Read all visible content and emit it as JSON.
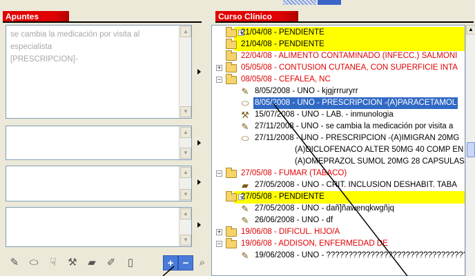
{
  "left_panel": {
    "title": "Apuntes",
    "notes": [
      {
        "text": "se cambia la medicación por visita al\nespecialista\n[PRESCRIPCION]-"
      },
      {
        "text": ""
      },
      {
        "text": ""
      },
      {
        "text": ""
      }
    ],
    "toolbar": [
      {
        "icon": "pen-stamp-icon",
        "glyph": "✎"
      },
      {
        "icon": "capsule-icon",
        "glyph": "⬭"
      },
      {
        "icon": "thumb-down-icon",
        "glyph": "☟"
      },
      {
        "icon": "hammer-icon",
        "glyph": "⚒"
      },
      {
        "icon": "bandage-icon",
        "glyph": "▰"
      },
      {
        "icon": "pencil-icon",
        "glyph": "✐"
      },
      {
        "icon": "document-icon",
        "glyph": "▯"
      },
      {
        "icon": "plus-icon",
        "glyph": "+"
      },
      {
        "icon": "minus-icon",
        "glyph": "−"
      },
      {
        "icon": "magnifier-icon",
        "glyph": "⌕"
      }
    ]
  },
  "right_panel": {
    "title": "Curso Clínico",
    "rows": [
      {
        "level": 0,
        "expander": "+",
        "icon": "folder",
        "style": "yellow",
        "text": "21/04/08 - PENDIENTE"
      },
      {
        "level": 0,
        "expander": "",
        "icon": "folder",
        "style": "yellow",
        "text": "21/04/08 - PENDIENTE"
      },
      {
        "level": 0,
        "expander": "",
        "icon": "folder",
        "style": "red",
        "text": "22/04/08 - ALIMENTO CONTAMINADO (INFECC.) SALMONI"
      },
      {
        "level": 0,
        "expander": "+",
        "icon": "folder",
        "style": "red",
        "text": "05/05/08 - CONTUSION CUTANEA, CON SUPERFICIE INTA"
      },
      {
        "level": 0,
        "expander": "−",
        "icon": "folder",
        "style": "red",
        "text": "08/05/08 - CEFALEA, NC"
      },
      {
        "level": 1,
        "expander": "",
        "icon": "pencil",
        "style": "",
        "text": "8/05/2008 - UNO - kjgjrrruryrr"
      },
      {
        "level": 1,
        "expander": "",
        "icon": "capsule",
        "style": "selected",
        "text": "8/05/2008 - UNO - PRESCRIPCION -(A)PARACETAMOL"
      },
      {
        "level": 1,
        "expander": "",
        "icon": "hammer",
        "style": "",
        "text": "15/07/2008 - UNO - LAB. - inmunologia"
      },
      {
        "level": 1,
        "expander": "",
        "icon": "pencil",
        "style": "",
        "text": "27/11/2008 - UNO - se cambia la medicación por visita a"
      },
      {
        "level": 1,
        "expander": "",
        "icon": "capsule",
        "style": "",
        "text": "27/11/2008 - UNO - PRESCRIPCION -(A)IMIGRAN 20MG"
      },
      {
        "level": 2,
        "expander": "",
        "icon": "",
        "style": "",
        "text": "(A)DICLOFENACO ALTER 50MG 40 COMP EN"
      },
      {
        "level": 2,
        "expander": "",
        "icon": "",
        "style": "",
        "text": "(A)OMEPRAZOL SUMOL 20MG 28 CAPSULAS"
      },
      {
        "level": 0,
        "expander": "−",
        "icon": "folder",
        "style": "red",
        "text": "27/05/08 - FUMAR (TABACO)"
      },
      {
        "level": 1,
        "expander": "",
        "icon": "bandage",
        "style": "",
        "text": "27/05/2008 - UNO - CRIT. INCLUSION DESHABIT. TABA"
      },
      {
        "level": 0,
        "expander": "−",
        "icon": "folder",
        "style": "yellow",
        "text": "27/05/08 - PENDIENTE"
      },
      {
        "level": 1,
        "expander": "",
        "icon": "pencil",
        "style": "",
        "text": "27/05/2008 - UNO - dañ]ñawenqkwgñjq"
      },
      {
        "level": 1,
        "expander": "",
        "icon": "pencil",
        "style": "",
        "text": "26/06/2008 - UNO - df"
      },
      {
        "level": 0,
        "expander": "+",
        "icon": "folder",
        "style": "red",
        "text": "19/06/08 - DIFICUL. HIJO/A"
      },
      {
        "level": 0,
        "expander": "−",
        "icon": "folder",
        "style": "red",
        "text": "19/06/08 - ADDISON, ENFERMEDAD DE"
      },
      {
        "level": 1,
        "expander": "",
        "icon": "pencil",
        "style": "",
        "text": "19/06/2008 - UNO - ??????????????????????????????????"
      }
    ]
  },
  "colors": {
    "title_red": "#e00000",
    "pending_yellow": "#ffff00",
    "selection_blue": "#316ac5",
    "problem_red": "#e00000"
  }
}
